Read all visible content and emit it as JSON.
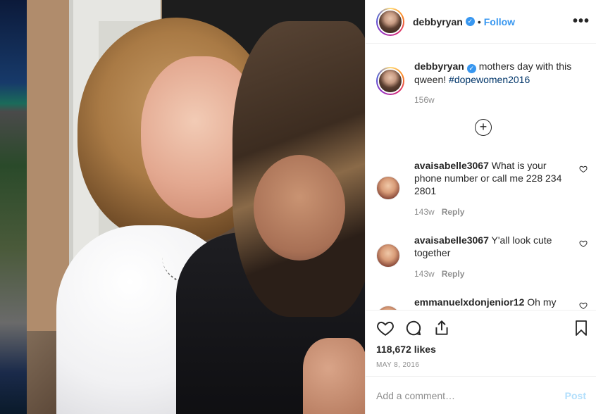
{
  "post": {
    "username": "debbyryan",
    "follow_label": "Follow",
    "separator": "•",
    "more_label": "•••",
    "caption_text": "mothers day with this qween!",
    "caption_hashtag": "#dopewomen2016",
    "caption_time": "156w",
    "load_more_label": "+",
    "likes": "118,672 likes",
    "date": "MAY 8, 2016",
    "comment_placeholder": "Add a comment…",
    "post_label": "Post"
  },
  "comments": [
    {
      "username": "avaisabelle3067",
      "text": "What is your phone number or call me 228 234 2801",
      "time": "143w",
      "reply": "Reply"
    },
    {
      "username": "avaisabelle3067",
      "text": "Y'all look cute together",
      "time": "143w",
      "reply": "Reply"
    },
    {
      "username": "emmanuelxdonjenior12",
      "text": "Oh my",
      "time": "",
      "reply": ""
    }
  ],
  "colors": {
    "link_blue": "#3897f0",
    "hashtag": "#003569",
    "muted": "#8e8e8e",
    "post_disabled": "#b2dffc"
  },
  "icons": [
    "heart-icon",
    "comment-icon",
    "share-icon",
    "bookmark-icon",
    "verified-icon",
    "plus-circle-icon",
    "more-icon"
  ]
}
